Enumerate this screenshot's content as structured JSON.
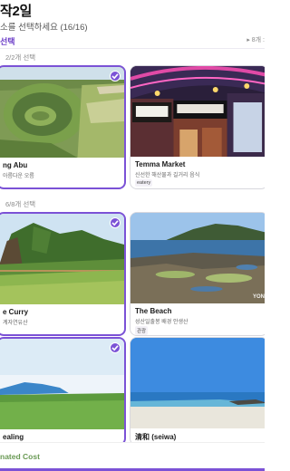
{
  "header": {
    "title": "작2일",
    "subtitle": "소를 선택하세요 (16/16)",
    "section_tab": "선택",
    "more_label": "▸ 8개 :"
  },
  "groups": [
    {
      "count_label": "2/2개 선택",
      "cards": [
        {
          "name": "ng Abu",
          "desc": "아름다운 오름",
          "tag": "",
          "selected": true
        },
        {
          "name": "Temma Market",
          "desc": "신선한 해산물과 길거리 음식",
          "tag": "eatery",
          "selected": false
        }
      ]
    },
    {
      "count_label": "6/8개 선택",
      "cards": [
        {
          "name": "e Curry",
          "desc": "계자연유산",
          "tag": "",
          "selected": true
        },
        {
          "name": "The Beach",
          "desc": "성산일출봉 배경 안생산",
          "tag": "관광",
          "selected": false,
          "watermark": "YON"
        }
      ]
    },
    {
      "count_label": "",
      "cards": [
        {
          "name": "ealing",
          "desc": "",
          "tag": "",
          "selected": true
        },
        {
          "name": "清和 (seiwa)",
          "desc": "",
          "tag": "",
          "selected": false
        }
      ]
    }
  ],
  "footer": {
    "cost_label": "nated Cost"
  },
  "colors": {
    "accent": "#7b52d6",
    "cost": "#6a9a55"
  }
}
